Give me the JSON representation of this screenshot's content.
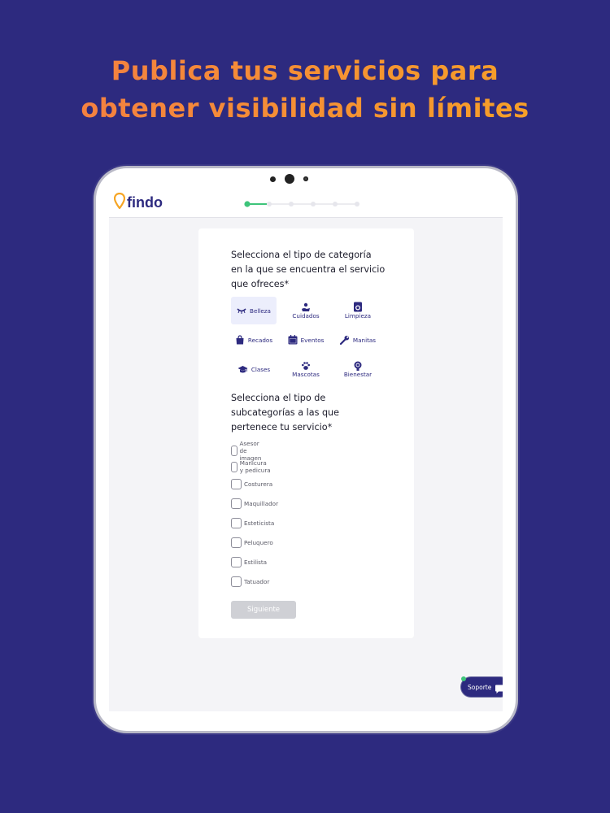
{
  "headline": {
    "line1": "Publica tus servicios para",
    "line2": "obtener visibilidad sin límites",
    "gradient_start": "#f47b45",
    "gradient_end": "#f6a524"
  },
  "app": {
    "logo_text": "findo",
    "logo_icon": "map-pin-icon",
    "brand_color": "#2d2a7f",
    "accent_color": "#f6a524",
    "progress": {
      "steps": 6,
      "current": 1,
      "color": "#3ec47a"
    }
  },
  "form": {
    "category_question": "Selecciona el tipo de categoría en la que se encuentra el servicio que ofreces*",
    "categories": [
      {
        "label": "Belleza",
        "icon": "eyelash-icon",
        "selected": true
      },
      {
        "label": "Cuidados",
        "icon": "hand-care-icon",
        "selected": false
      },
      {
        "label": "Limpieza",
        "icon": "washing-machine-icon",
        "selected": false
      },
      {
        "label": "Recados",
        "icon": "shopping-bag-icon",
        "selected": false
      },
      {
        "label": "Eventos",
        "icon": "calendar-icon",
        "selected": false
      },
      {
        "label": "Manitas",
        "icon": "wrench-icon",
        "selected": false
      },
      {
        "label": "Clases",
        "icon": "graduation-cap-icon",
        "selected": false
      },
      {
        "label": "Mascotas",
        "icon": "paw-icon",
        "selected": false
      },
      {
        "label": "Bienestar",
        "icon": "wellness-head-icon",
        "selected": false
      }
    ],
    "subcategory_question": "Selecciona el tipo de subcategorías a las que pertenece tu servicio*",
    "subcategories": [
      "Asesor de imagen",
      "Manicura y pedicura",
      "Costurera",
      "Maquillador",
      "Esteticista",
      "Peluquero",
      "Estilista",
      "Tatuador"
    ],
    "next_button": "Siguiente"
  },
  "support": {
    "label": "Soporte",
    "icon": "chat-bubble-icon",
    "status_color": "#3ec47a"
  }
}
